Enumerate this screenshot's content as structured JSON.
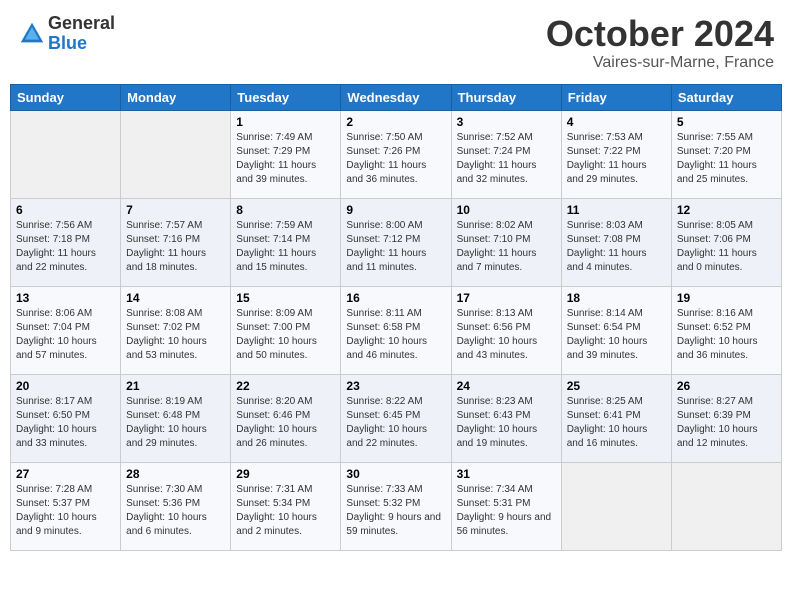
{
  "header": {
    "logo_general": "General",
    "logo_blue": "Blue",
    "month_title": "October 2024",
    "location": "Vaires-sur-Marne, France"
  },
  "weekdays": [
    "Sunday",
    "Monday",
    "Tuesday",
    "Wednesday",
    "Thursday",
    "Friday",
    "Saturday"
  ],
  "weeks": [
    [
      {
        "day": "",
        "info": ""
      },
      {
        "day": "",
        "info": ""
      },
      {
        "day": "1",
        "info": "Sunrise: 7:49 AM\nSunset: 7:29 PM\nDaylight: 11 hours and 39 minutes."
      },
      {
        "day": "2",
        "info": "Sunrise: 7:50 AM\nSunset: 7:26 PM\nDaylight: 11 hours and 36 minutes."
      },
      {
        "day": "3",
        "info": "Sunrise: 7:52 AM\nSunset: 7:24 PM\nDaylight: 11 hours and 32 minutes."
      },
      {
        "day": "4",
        "info": "Sunrise: 7:53 AM\nSunset: 7:22 PM\nDaylight: 11 hours and 29 minutes."
      },
      {
        "day": "5",
        "info": "Sunrise: 7:55 AM\nSunset: 7:20 PM\nDaylight: 11 hours and 25 minutes."
      }
    ],
    [
      {
        "day": "6",
        "info": "Sunrise: 7:56 AM\nSunset: 7:18 PM\nDaylight: 11 hours and 22 minutes."
      },
      {
        "day": "7",
        "info": "Sunrise: 7:57 AM\nSunset: 7:16 PM\nDaylight: 11 hours and 18 minutes."
      },
      {
        "day": "8",
        "info": "Sunrise: 7:59 AM\nSunset: 7:14 PM\nDaylight: 11 hours and 15 minutes."
      },
      {
        "day": "9",
        "info": "Sunrise: 8:00 AM\nSunset: 7:12 PM\nDaylight: 11 hours and 11 minutes."
      },
      {
        "day": "10",
        "info": "Sunrise: 8:02 AM\nSunset: 7:10 PM\nDaylight: 11 hours and 7 minutes."
      },
      {
        "day": "11",
        "info": "Sunrise: 8:03 AM\nSunset: 7:08 PM\nDaylight: 11 hours and 4 minutes."
      },
      {
        "day": "12",
        "info": "Sunrise: 8:05 AM\nSunset: 7:06 PM\nDaylight: 11 hours and 0 minutes."
      }
    ],
    [
      {
        "day": "13",
        "info": "Sunrise: 8:06 AM\nSunset: 7:04 PM\nDaylight: 10 hours and 57 minutes."
      },
      {
        "day": "14",
        "info": "Sunrise: 8:08 AM\nSunset: 7:02 PM\nDaylight: 10 hours and 53 minutes."
      },
      {
        "day": "15",
        "info": "Sunrise: 8:09 AM\nSunset: 7:00 PM\nDaylight: 10 hours and 50 minutes."
      },
      {
        "day": "16",
        "info": "Sunrise: 8:11 AM\nSunset: 6:58 PM\nDaylight: 10 hours and 46 minutes."
      },
      {
        "day": "17",
        "info": "Sunrise: 8:13 AM\nSunset: 6:56 PM\nDaylight: 10 hours and 43 minutes."
      },
      {
        "day": "18",
        "info": "Sunrise: 8:14 AM\nSunset: 6:54 PM\nDaylight: 10 hours and 39 minutes."
      },
      {
        "day": "19",
        "info": "Sunrise: 8:16 AM\nSunset: 6:52 PM\nDaylight: 10 hours and 36 minutes."
      }
    ],
    [
      {
        "day": "20",
        "info": "Sunrise: 8:17 AM\nSunset: 6:50 PM\nDaylight: 10 hours and 33 minutes."
      },
      {
        "day": "21",
        "info": "Sunrise: 8:19 AM\nSunset: 6:48 PM\nDaylight: 10 hours and 29 minutes."
      },
      {
        "day": "22",
        "info": "Sunrise: 8:20 AM\nSunset: 6:46 PM\nDaylight: 10 hours and 26 minutes."
      },
      {
        "day": "23",
        "info": "Sunrise: 8:22 AM\nSunset: 6:45 PM\nDaylight: 10 hours and 22 minutes."
      },
      {
        "day": "24",
        "info": "Sunrise: 8:23 AM\nSunset: 6:43 PM\nDaylight: 10 hours and 19 minutes."
      },
      {
        "day": "25",
        "info": "Sunrise: 8:25 AM\nSunset: 6:41 PM\nDaylight: 10 hours and 16 minutes."
      },
      {
        "day": "26",
        "info": "Sunrise: 8:27 AM\nSunset: 6:39 PM\nDaylight: 10 hours and 12 minutes."
      }
    ],
    [
      {
        "day": "27",
        "info": "Sunrise: 7:28 AM\nSunset: 5:37 PM\nDaylight: 10 hours and 9 minutes."
      },
      {
        "day": "28",
        "info": "Sunrise: 7:30 AM\nSunset: 5:36 PM\nDaylight: 10 hours and 6 minutes."
      },
      {
        "day": "29",
        "info": "Sunrise: 7:31 AM\nSunset: 5:34 PM\nDaylight: 10 hours and 2 minutes."
      },
      {
        "day": "30",
        "info": "Sunrise: 7:33 AM\nSunset: 5:32 PM\nDaylight: 9 hours and 59 minutes."
      },
      {
        "day": "31",
        "info": "Sunrise: 7:34 AM\nSunset: 5:31 PM\nDaylight: 9 hours and 56 minutes."
      },
      {
        "day": "",
        "info": ""
      },
      {
        "day": "",
        "info": ""
      }
    ]
  ]
}
